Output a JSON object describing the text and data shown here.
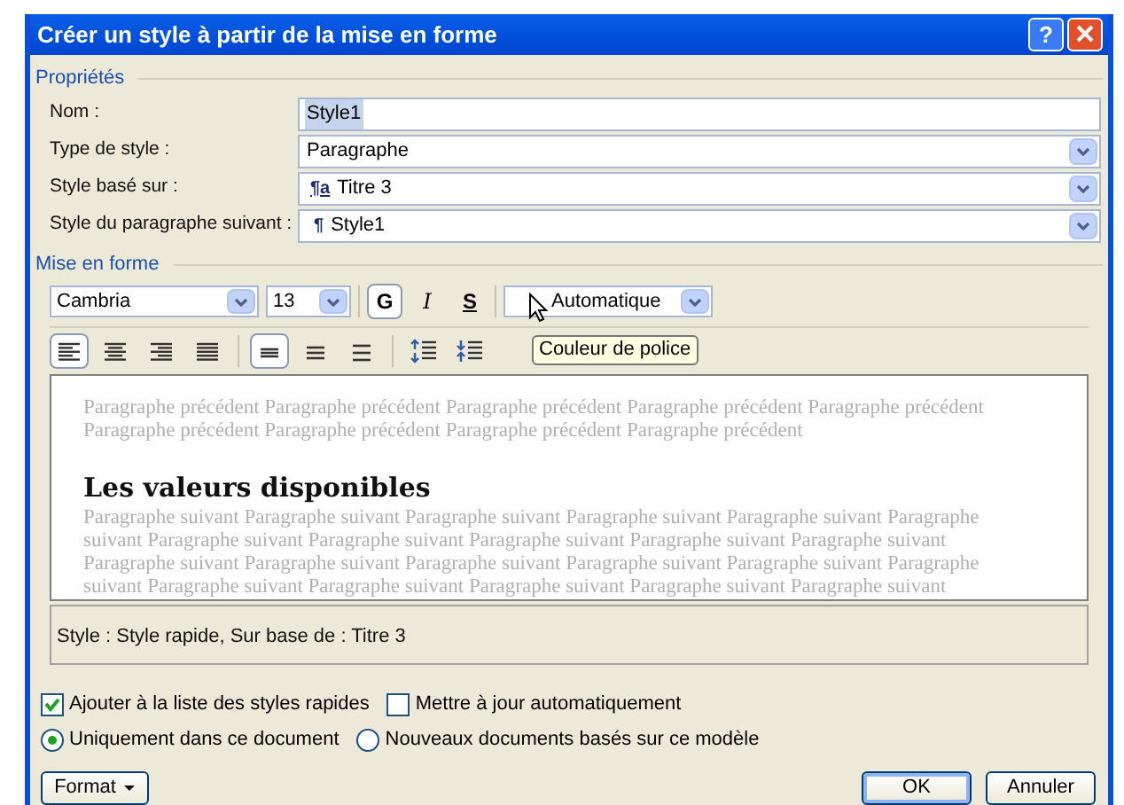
{
  "window": {
    "title": "Créer un style à partir de la mise en forme",
    "help": "?"
  },
  "properties": {
    "legend": "Propriétés",
    "fields": [
      {
        "kind": "text",
        "label": "Nom :",
        "value": "Style1",
        "selected": true
      },
      {
        "kind": "select",
        "label": "Type de style :",
        "value": "Paragraphe"
      },
      {
        "kind": "select",
        "label": "Style basé sur :",
        "value": "Titre 3",
        "icon": "¶a"
      },
      {
        "kind": "select",
        "label": "Style du paragraphe suivant :",
        "value": "Style1",
        "icon": "¶"
      }
    ]
  },
  "formatting": {
    "legend": "Mise en forme",
    "font": "Cambria",
    "size": "13",
    "styles": [
      {
        "kind": "bold",
        "label": "G",
        "selected": true
      },
      {
        "kind": "italic",
        "label": "I",
        "selected": false
      },
      {
        "kind": "underline",
        "label": "S",
        "selected": false
      }
    ],
    "font_color": "Automatique",
    "tooltip": "Couleur de police",
    "alignment": [
      {
        "kind": "left",
        "selected": true
      },
      {
        "kind": "center",
        "selected": false
      },
      {
        "kind": "right",
        "selected": false
      },
      {
        "kind": "justify",
        "selected": false
      }
    ],
    "spacing": [
      {
        "kind": "single",
        "selected": true
      },
      {
        "kind": "onehalf",
        "selected": false
      },
      {
        "kind": "double",
        "selected": false
      }
    ],
    "paragraph": [
      {
        "kind": "space-up"
      },
      {
        "kind": "space-down"
      }
    ]
  },
  "preview": {
    "before": [
      "Paragraphe précédent Paragraphe précédent Paragraphe précédent Paragraphe précédent Paragraphe précédent",
      "Paragraphe précédent Paragraphe précédent Paragraphe précédent Paragraphe précédent"
    ],
    "heading": "Les valeurs disponibles",
    "after": [
      "Paragraphe suivant Paragraphe suivant Paragraphe suivant Paragraphe suivant Paragraphe suivant Paragraphe",
      "suivant Paragraphe suivant Paragraphe suivant Paragraphe suivant Paragraphe suivant Paragraphe suivant",
      "Paragraphe suivant Paragraphe suivant Paragraphe suivant Paragraphe suivant Paragraphe suivant Paragraphe",
      "suivant Paragraphe suivant Paragraphe suivant Paragraphe suivant Paragraphe suivant Paragraphe suivant"
    ]
  },
  "description": "Style : Style rapide, Sur base de : Titre 3",
  "checkboxes": [
    {
      "label": "Ajouter à la liste des styles rapides",
      "checked": true
    },
    {
      "label": "Mettre à jour automatiquement",
      "checked": false
    }
  ],
  "radios": [
    {
      "label": "Uniquement dans ce document",
      "selected": true
    },
    {
      "label": "Nouveaux documents basés sur ce modèle",
      "selected": false
    }
  ],
  "buttons": [
    {
      "kind": "menu",
      "label": "Format"
    },
    {
      "kind": "default",
      "label": "OK"
    },
    {
      "kind": "plain",
      "label": "Annuler"
    }
  ]
}
